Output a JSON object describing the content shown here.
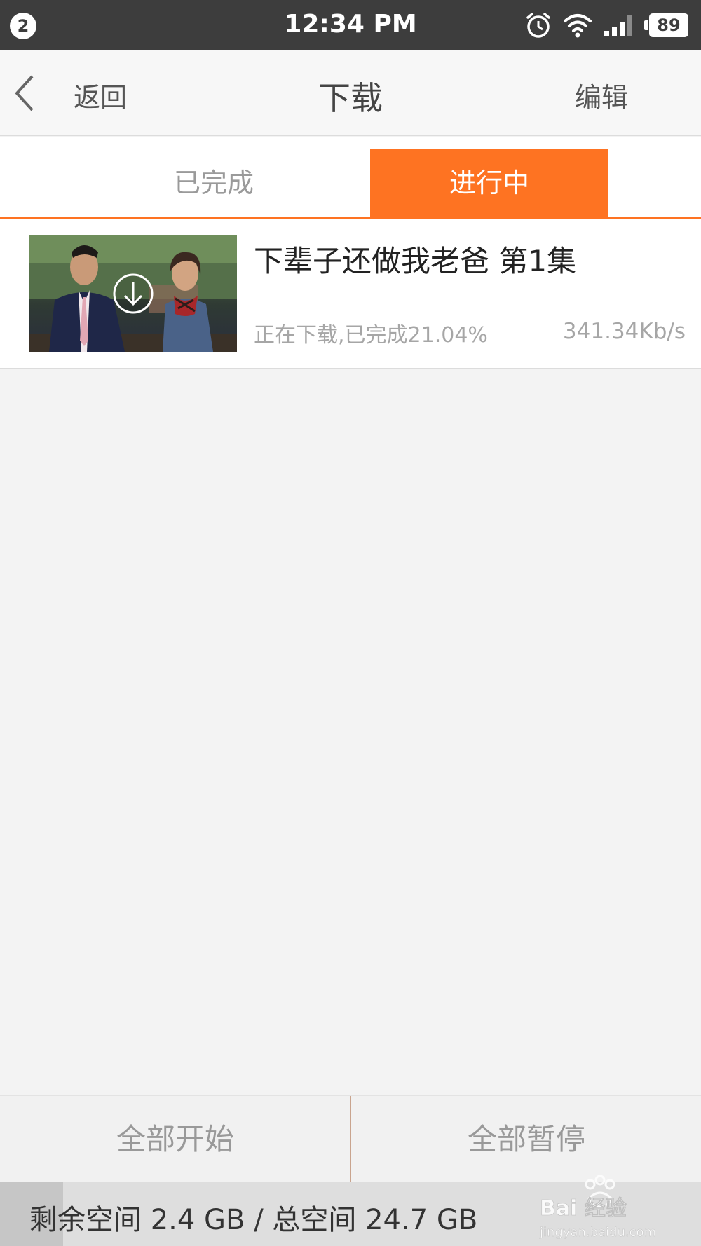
{
  "status_bar": {
    "notification_count": "2",
    "time": "12:34 PM",
    "battery": "89",
    "icons": [
      "alarm-icon",
      "wifi-icon",
      "signal-icon",
      "battery-icon"
    ]
  },
  "nav": {
    "back_label": "返回",
    "title": "下载",
    "edit_label": "编辑"
  },
  "tabs": [
    {
      "label": "已完成",
      "active": false
    },
    {
      "label": "进行中",
      "active": true
    }
  ],
  "downloads": [
    {
      "title": "下辈子还做我老爸  第1集",
      "status": "正在下载,已完成21.04%",
      "progress_percent": 21.04,
      "speed": "341.34Kb/s"
    }
  ],
  "actions": {
    "start_all": "全部开始",
    "pause_all": "全部暂停"
  },
  "storage": {
    "text": "剩余空间 2.4 GB / 总空间 24.7 GB",
    "free_gb": 2.4,
    "total_gb": 24.7
  },
  "watermark": {
    "brand": "Bai 经验",
    "url": "jingyan.baidu.com"
  },
  "colors": {
    "accent": "#fe7322",
    "status_bar": "#3d3d3d",
    "background": "#f3f3f3"
  }
}
